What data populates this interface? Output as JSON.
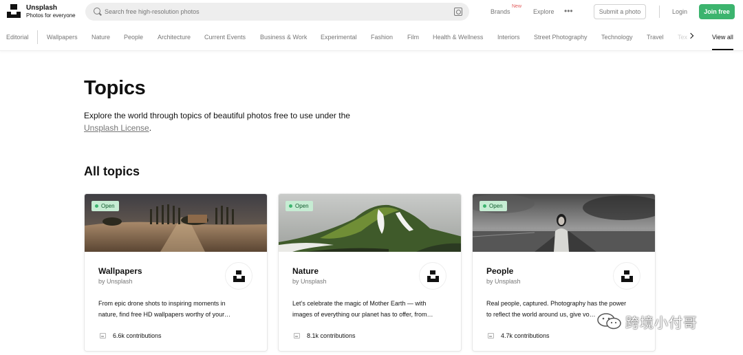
{
  "header": {
    "brand_name": "Unsplash",
    "brand_tagline": "Photos for everyone",
    "search_placeholder": "Search free high-resolution photos",
    "nav_brands": "Brands",
    "nav_brands_badge": "New",
    "nav_explore": "Explore",
    "more_glyph": "•••",
    "submit_label": "Submit a photo",
    "login_label": "Login",
    "join_label": "Join free"
  },
  "topic_nav": {
    "items": [
      "Editorial",
      "Wallpapers",
      "Nature",
      "People",
      "Architecture",
      "Current Events",
      "Business & Work",
      "Experimental",
      "Fashion",
      "Film",
      "Health & Wellness",
      "Interiors",
      "Street Photography",
      "Technology",
      "Travel",
      "Textures"
    ],
    "view_all": "View all"
  },
  "main": {
    "title": "Topics",
    "description": "Explore the world through topics of beautiful photos free to use under the",
    "license_link": "Unsplash License",
    "license_suffix": ".",
    "section_title": "All topics"
  },
  "cards": [
    {
      "status": "Open",
      "title": "Wallpapers",
      "byline": "by Unsplash",
      "desc_line1": "From epic drone shots to inspiring moments in",
      "desc_line2": "nature, find free HD wallpapers worthy of your…",
      "contributions": "6.6k contributions"
    },
    {
      "status": "Open",
      "title": "Nature",
      "byline": "by Unsplash",
      "desc_line1": "Let’s celebrate the magic of Mother Earth — with",
      "desc_line2": "images of everything our planet has to offer, from…",
      "contributions": "8.1k contributions"
    },
    {
      "status": "Open",
      "title": "People",
      "byline": "by Unsplash",
      "desc_line1": "Real people, captured. Photography has the power",
      "desc_line2": "to reflect the world around us, give vo…",
      "contributions": "4.7k contributions"
    }
  ],
  "watermark": {
    "text": "跨境小付哥"
  },
  "colors": {
    "accent_green": "#3cb46e",
    "status_pill_bg": "#c6ecd3",
    "new_badge": "#e25c5c",
    "muted_text": "#767676"
  },
  "icons": [
    "unsplash-logo",
    "search-icon",
    "visual-search-icon",
    "more-icon",
    "chevron-right-icon",
    "image-icon",
    "wechat-icon"
  ]
}
